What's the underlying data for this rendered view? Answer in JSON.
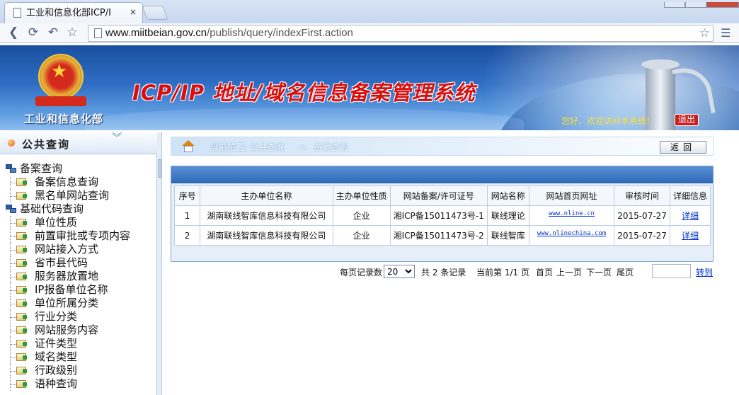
{
  "browser": {
    "tab_title": "工业和信息化部ICP/I",
    "tab_close": "×",
    "url_host": "www.miitbeian.gov.cn",
    "url_path": "/publish/query/indexFirst.action"
  },
  "header": {
    "ministry": "工业和信息化部",
    "system_title": "ICP/IP 地址/域名信息备案管理系统",
    "welcome": "您好，欢迎访问本系统!",
    "logout": "退出"
  },
  "sidebar": {
    "title": "公共查询",
    "groups": [
      {
        "label": "备案查询",
        "items": [
          "备案信息查询",
          "黑名单网站查询"
        ]
      },
      {
        "label": "基础代码查询",
        "items": [
          "单位性质",
          "前置审批或专项内容",
          "网站接入方式",
          "省市县代码",
          "服务器放置地",
          "IP报备单位名称",
          "单位所属分类",
          "行业分类",
          "网站服务内容",
          "证件类型",
          "域名类型",
          "行政级别",
          "语种查询"
        ]
      }
    ]
  },
  "breadcrumb": {
    "prefix": "当前位置:",
    "section": "公共查询",
    "arrow": "->",
    "page": "备案查询",
    "back": "返回"
  },
  "table": {
    "headers": [
      "序号",
      "主办单位名称",
      "主办单位性质",
      "网站备案/许可证号",
      "网站名称",
      "网站首页网址",
      "审核时间",
      "详细信息"
    ],
    "rows": [
      {
        "no": "1",
        "org": "湖南联线智库信息科技有限公司",
        "type": "企业",
        "license": "湘ICP备15011473号-1",
        "site": "联线理论",
        "url": "www.nline.cn",
        "date": "2015-07-27",
        "detail": "详细"
      },
      {
        "no": "2",
        "org": "湖南联线智库信息科技有限公司",
        "type": "企业",
        "license": "湘ICP备15011473号-2",
        "site": "联线智库",
        "url": "www.nlinechina.com",
        "date": "2015-07-27",
        "detail": "详细"
      }
    ]
  },
  "pager": {
    "per_page_label": "每页记录数",
    "per_page_value": "20",
    "total": "共 2 条记录",
    "current": "当前第 1/1 页",
    "first": "首页",
    "prev": "上一页",
    "next": "下一页",
    "last": "尾页",
    "go": "转到"
  }
}
